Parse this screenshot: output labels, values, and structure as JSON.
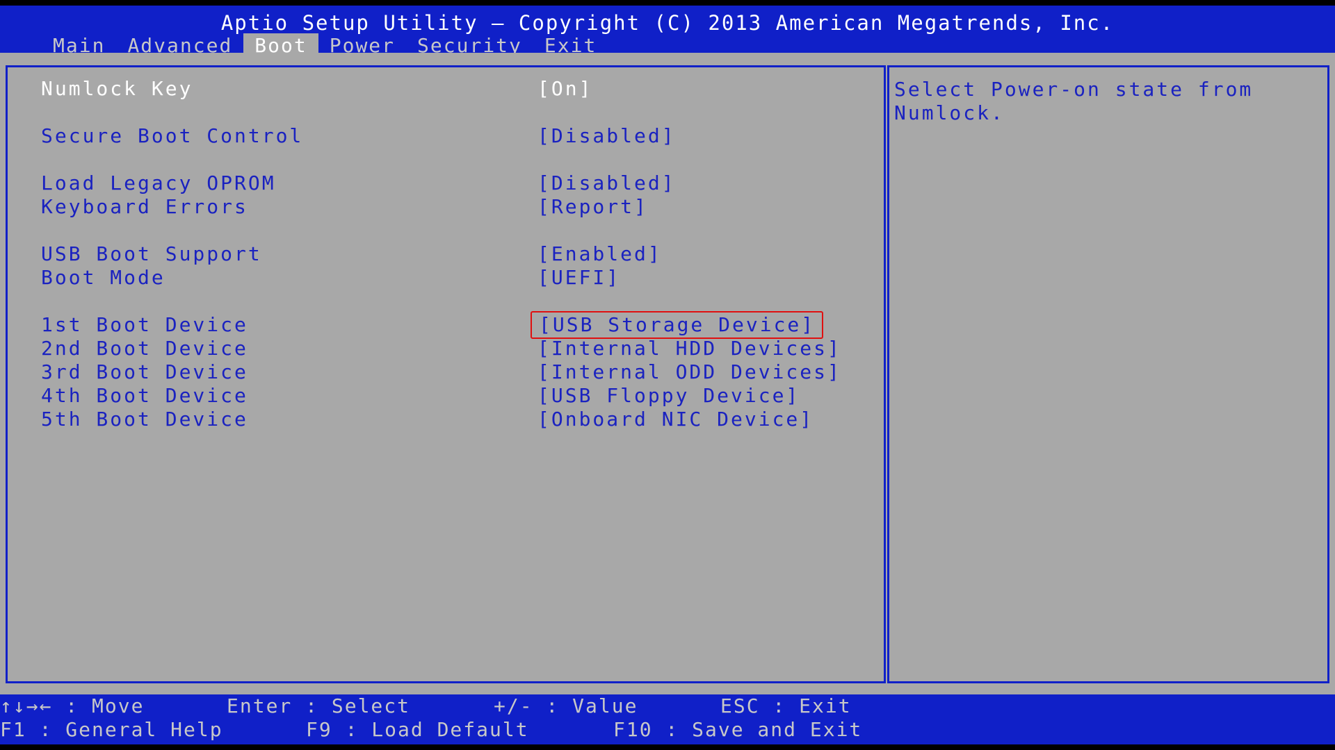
{
  "header": {
    "title": "Aptio Setup Utility – Copyright (C) 2013 American Megatrends, Inc.",
    "tabs": [
      {
        "label": "Main"
      },
      {
        "label": "Advanced"
      },
      {
        "label": "Boot"
      },
      {
        "label": "Power"
      },
      {
        "label": "Security"
      },
      {
        "label": "Exit"
      }
    ],
    "active_tab": "Boot"
  },
  "settings": [
    {
      "label": "Numlock Key",
      "value": "[On]"
    },
    {
      "label": "Secure Boot Control",
      "value": "[Disabled]"
    },
    {
      "label": "Load Legacy OPROM",
      "value": "[Disabled]"
    },
    {
      "label": "Keyboard Errors",
      "value": "[Report]"
    },
    {
      "label": "USB Boot Support",
      "value": "[Enabled]"
    },
    {
      "label": "Boot Mode",
      "value": "[UEFI]"
    },
    {
      "label": "1st Boot Device",
      "value": "[USB Storage Device]"
    },
    {
      "label": "2nd Boot Device",
      "value": "[Internal HDD Devices]"
    },
    {
      "label": "3rd Boot Device",
      "value": "[Internal ODD Devices]"
    },
    {
      "label": "4th Boot Device",
      "value": "[USB Floppy Device]"
    },
    {
      "label": "5th Boot Device",
      "value": "[Onboard NIC Device]"
    }
  ],
  "help": {
    "text": "Select Power-on state from Numlock."
  },
  "footer": {
    "move": "↑↓→← : Move",
    "select": "Enter : Select",
    "value": "+/- : Value",
    "esc": "ESC : Exit",
    "f1": "F1 : General Help",
    "f9": "F9 : Load Default",
    "f10": "F10 : Save and Exit"
  },
  "colors": {
    "header_blue": "#1020C8",
    "panel_grey": "#A8A8A8",
    "item_blue": "#1A22C0",
    "highlight_red": "#E01010"
  }
}
